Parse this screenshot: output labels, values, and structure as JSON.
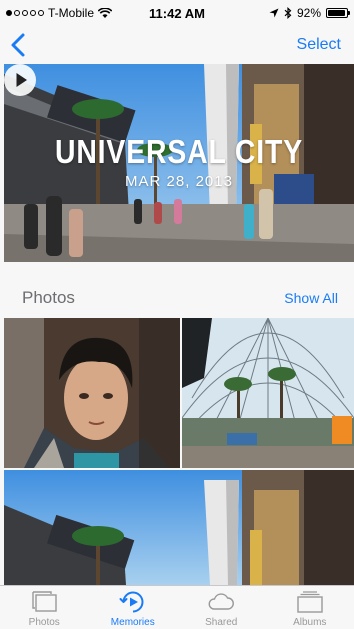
{
  "status_bar": {
    "carrier": "T-Mobile",
    "time": "11:42 AM",
    "battery": "92%",
    "battery_level": 0.92,
    "signal_bars_filled": 1,
    "signal_bars_total": 5
  },
  "nav": {
    "back_icon": "chevron-left-icon",
    "select_label": "Select"
  },
  "hero": {
    "title": "UNIVERSAL CITY",
    "date": "MAR 28, 2013",
    "play_icon": "play-icon"
  },
  "photos_section": {
    "title": "Photos",
    "show_all_label": "Show All"
  },
  "tabs": [
    {
      "label": "Photos",
      "icon": "photos-icon",
      "active": false
    },
    {
      "label": "Memories",
      "icon": "memories-icon",
      "active": true
    },
    {
      "label": "Shared",
      "icon": "cloud-icon",
      "active": false
    },
    {
      "label": "Albums",
      "icon": "albums-icon",
      "active": false
    }
  ],
  "colors": {
    "accent": "#1a7cf5",
    "inactive": "#999999",
    "section_text": "#6d6d72"
  }
}
